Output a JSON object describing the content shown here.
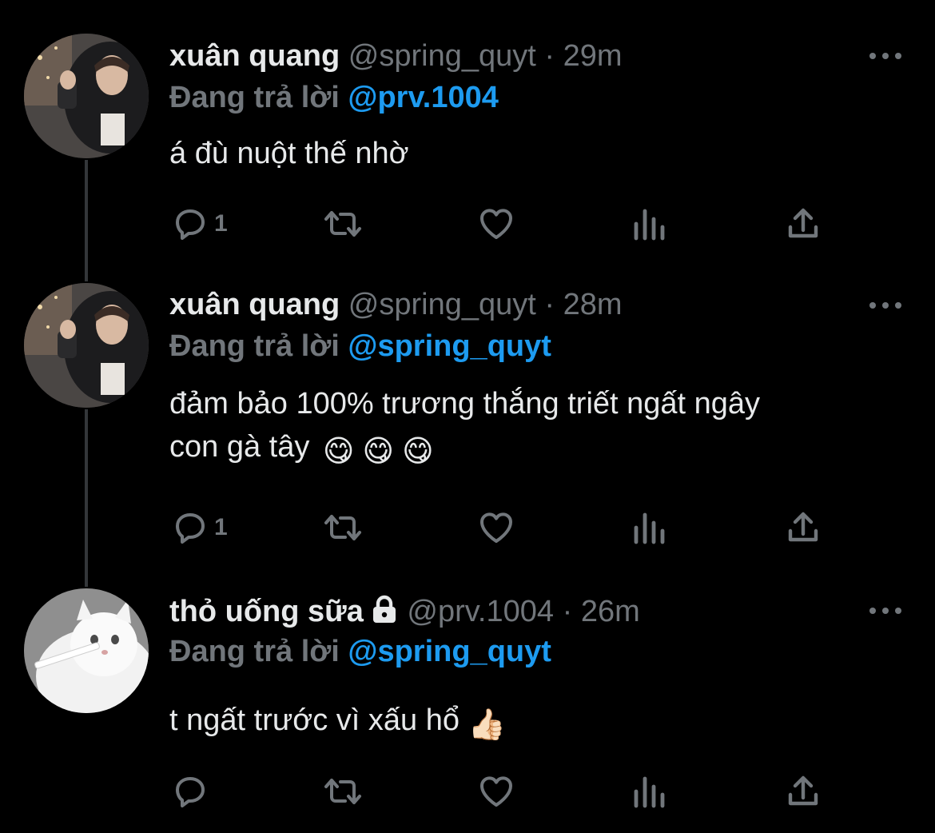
{
  "tweets": [
    {
      "name": "xuân quang",
      "handle": "@spring_quyt",
      "separator": "·",
      "time": "29m",
      "reply_prefix": "Đang trả lời",
      "reply_to": "@prv.1004",
      "text": "á đù nuột thế nhờ",
      "emojis": [],
      "reply_count": "1",
      "avatar": "man-photo",
      "locked": false
    },
    {
      "name": "xuân quang",
      "handle": "@spring_quyt",
      "separator": "·",
      "time": "28m",
      "reply_prefix": "Đang trả lời",
      "reply_to": "@spring_quyt",
      "text_line1": "đảm bảo 100% trương thắng triết ngất ngây",
      "text_line2": "con gà tây",
      "emojis": [
        "😋",
        "😋",
        "😋"
      ],
      "reply_count": "1",
      "avatar": "man-photo",
      "locked": false
    },
    {
      "name": "thỏ uống sữa",
      "handle": "@prv.1004",
      "separator": "·",
      "time": "26m",
      "reply_prefix": "Đang trả lời",
      "reply_to": "@spring_quyt",
      "text": "t ngất trước vì xấu hổ",
      "emojis": [
        "👍🏻"
      ],
      "reply_count": "",
      "avatar": "white-cat-photo",
      "locked": true
    }
  ],
  "icons": [
    "reply-icon",
    "retweet-icon",
    "like-icon",
    "analytics-icon",
    "share-icon",
    "more-icon",
    "lock-icon"
  ],
  "colors": {
    "background": "#000000",
    "text": "#e7e9ea",
    "muted": "#71767b",
    "link": "#1d9bf0",
    "thread_line": "#333639"
  }
}
